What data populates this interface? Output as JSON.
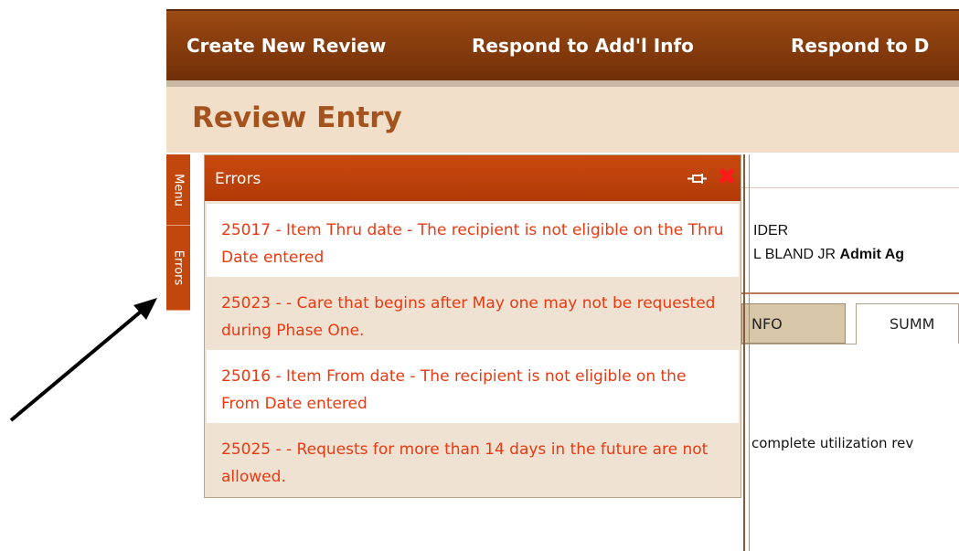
{
  "nav": {
    "items": [
      "Create New Review",
      "Respond to Add'l Info",
      "Respond to D"
    ]
  },
  "header": {
    "title": "Review Entry"
  },
  "side_tabs": {
    "menu": "Menu",
    "errors": "Errors"
  },
  "errors_panel": {
    "title": "Errors",
    "errors": [
      "25017 - Item Thru date - The recipient is not eligible on the Thru Date entered",
      "25023 - - Care that begins after May one may not be requested during Phase One.",
      "25016 - Item From date - The recipient is not eligible on the From Date entered",
      "25025 - - Requests for more than 14 days in the future are not allowed."
    ]
  },
  "background": {
    "line1": "IDER",
    "line2_name": "L BLAND JR ",
    "line2_label": "Admit Ag",
    "tab_info": "NFO",
    "tab_summary": "SUMM",
    "body_text": "complete utilization rev"
  },
  "colors": {
    "nav_bg": "#843a0c",
    "header_bg": "#f1dfc9",
    "title_color": "#a4531f",
    "error_text": "#e83a12",
    "panel_header": "#c84a10"
  }
}
